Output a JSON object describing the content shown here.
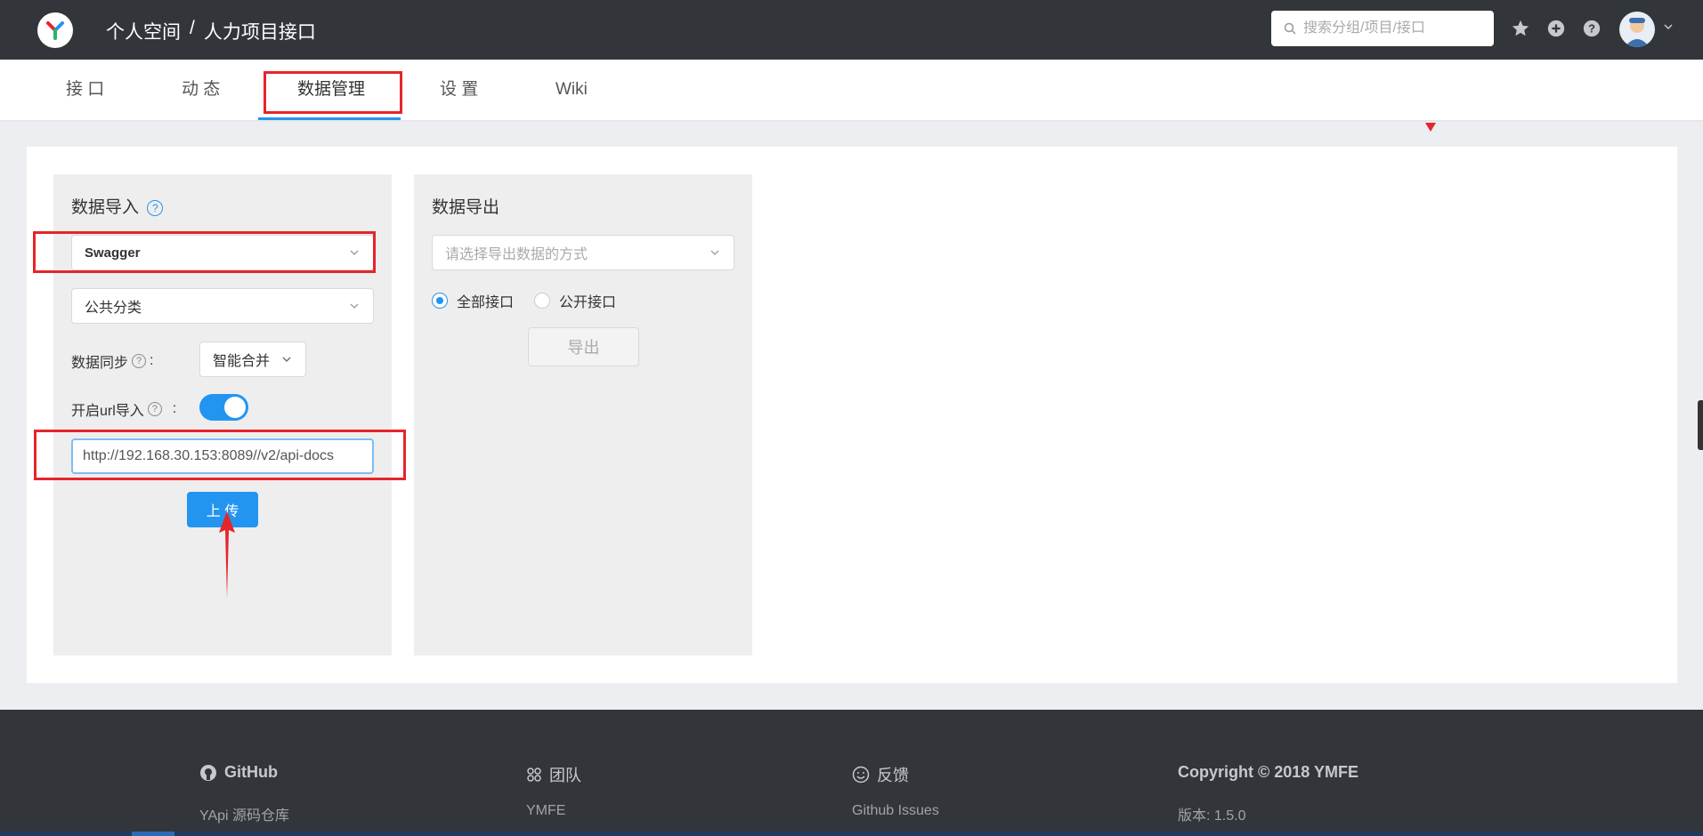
{
  "header": {
    "breadcrumb": [
      "个人空间",
      "/",
      "人力项目接口"
    ],
    "search_placeholder": "搜索分组/项目/接口"
  },
  "tabs": [
    {
      "label": "接 口"
    },
    {
      "label": "动 态"
    },
    {
      "label": "数据管理",
      "active": true
    },
    {
      "label": "设 置"
    },
    {
      "label": "Wiki"
    }
  ],
  "import_panel": {
    "title": "数据导入",
    "type_value": "Swagger",
    "category_value": "公共分类",
    "sync_label": "数据同步",
    "sync_value": "智能合并",
    "url_import_label": "开启url导入",
    "url_import_enabled": true,
    "url_value": "http://192.168.30.153:8089//v2/api-docs",
    "upload_label": "上 传"
  },
  "export_panel": {
    "title": "数据导出",
    "format_placeholder": "请选择导出数据的方式",
    "radio_all": "全部接口",
    "radio_public": "公开接口",
    "export_label": "导出"
  },
  "footer": {
    "col1": {
      "title": "GitHub",
      "link": "YApi 源码仓库"
    },
    "col2": {
      "title": "团队",
      "link": "YMFE"
    },
    "col3": {
      "title": "反馈",
      "link": "Github Issues"
    },
    "col4": {
      "title": "Copyright © 2018 YMFE",
      "link": "版本: 1.5.0"
    }
  },
  "colors": {
    "accent": "#2395f1",
    "header_bg": "#32363a",
    "highlight": "#e5252a"
  }
}
